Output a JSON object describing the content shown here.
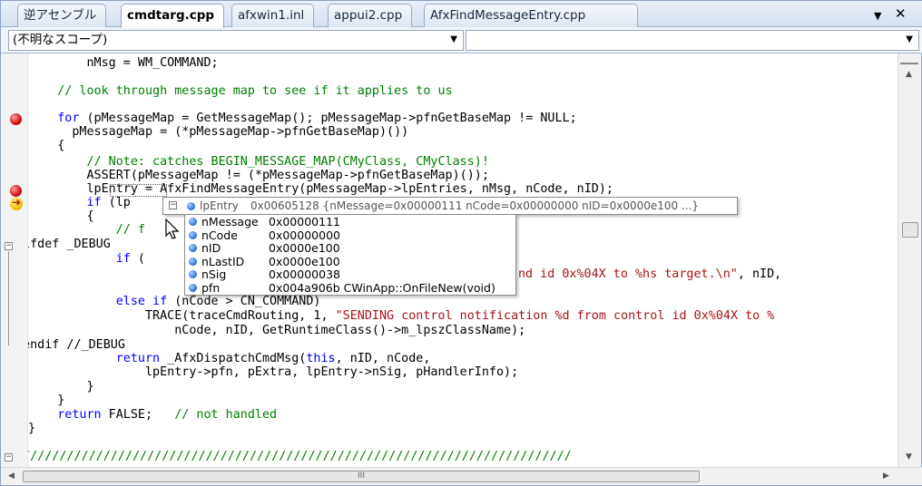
{
  "tabs": {
    "disasm": "逆アセンブル",
    "items": [
      "cmdtarg.cpp",
      "afxwin1.inl",
      "appui2.cpp",
      "AfxFindMessageEntry.cpp"
    ],
    "active": "cmdtarg.cpp",
    "menu_glyph": "▼",
    "close_glyph": "✕"
  },
  "scope": {
    "left": "(不明なスコープ)",
    "right": ""
  },
  "code": {
    "l1": "        nMsg = WM_COMMAND;",
    "l2": "    // look through message map to see if it applies to us",
    "l3a": "    for",
    "l3b": " (pMessageMap = GetMessageMap(); pMessageMap->pfnGetBaseMap != NULL;",
    "l4": "      pMessageMap = (*pMessageMap->pfnGetBaseMap)())",
    "l5": "    {",
    "l6": "        // Note: catches BEGIN_MESSAGE_MAP(CMyClass, CMyClass)!",
    "l7": "        ASSERT(pMessageMap != (*pMessageMap->pfnGetBaseMap)());",
    "l8": "        lpEntry = AfxFindMessageEntry(pMessageMap->lpEntries, nMsg, nCode, nID);",
    "l9a": "        if",
    "l9b": " (lp",
    "l10": "        {",
    "l11": "            // f",
    "l12": "#ifdef _DEBUG",
    "l13a": "            if",
    "l13b": " (",
    "l14a": "nd id 0x%04X to %hs target.\\n\"",
    "l14b": ", nID,",
    "l15a": "            else if",
    "l15b": " (nCode > CN_COMMAND)",
    "l16a": "                TRACE(traceCmdRouting, 1, ",
    "l16b": "\"SENDING control notification %d from control id 0x%04X to %",
    "l17": "                    nCode, nID, GetRuntimeClass()->m_lpszClassName);",
    "l18": "#endif //_DEBUG",
    "l19a": "            return",
    "l19b": " _AfxDispatchCmdMsg(",
    "l19c": "this",
    "l19d": ", nID, nCode,",
    "l20": "                lpEntry->pfn, pExtra, lpEntry->nSig, pHandlerInfo);",
    "l21": "        }",
    "l22": "    }",
    "l23a": "    return",
    "l23b": " FALSE;   ",
    "l23c": "// not handled",
    "l24": "}",
    "l25": "////////////////////////////////////////////////////////////////////////////"
  },
  "datatip": {
    "header_name": "lpEntry",
    "header_value": "0x00605128 {nMessage=0x00000111 nCode=0x00000000 nID=0x0000e100 ...}",
    "rows": [
      {
        "name": "nMessage",
        "value": "0x00000111"
      },
      {
        "name": "nCode",
        "value": "0x00000000"
      },
      {
        "name": "nID",
        "value": "0x0000e100"
      },
      {
        "name": "nLastID",
        "value": "0x0000e100"
      },
      {
        "name": "nSig",
        "value": "0x00000038"
      },
      {
        "name": "pfn",
        "value": "0x004a906b CWinApp::OnFileNew(void)"
      }
    ]
  },
  "hscroll_grip": "III",
  "colors": {
    "keyword": "#0000ff",
    "comment": "#008000",
    "string": "#a31515",
    "breakpoint": "#d01010",
    "current_line_arrow": "#f0b800"
  },
  "icons": {
    "breakpoint": "breakpoint-icon",
    "instruction_pointer": "instruction-pointer-icon",
    "member": "member-icon",
    "expand": "minus-expand-icon"
  }
}
